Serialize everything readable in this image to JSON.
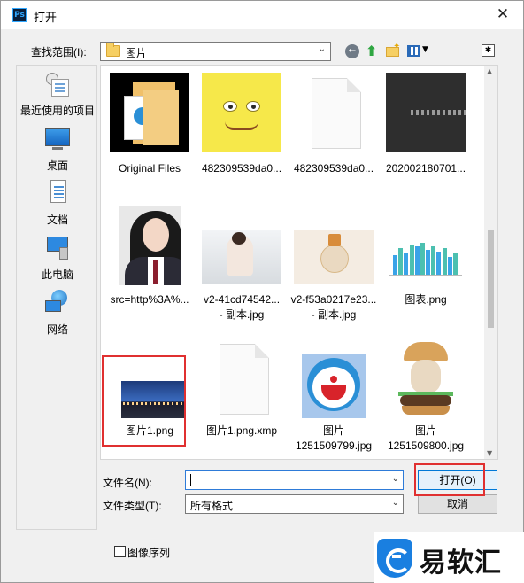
{
  "window": {
    "app_icon_text": "Ps",
    "title": "打开",
    "close_glyph": "✕"
  },
  "toolbar": {
    "lookin_label": "查找范围(I):",
    "lookin_value": "图片",
    "icons": [
      "back-icon",
      "up-folder-icon",
      "new-folder-icon",
      "view-menu-icon",
      "favorite-icon"
    ]
  },
  "places": [
    {
      "label": "最近使用的项目",
      "icon": "recent-items-icon"
    },
    {
      "label": "桌面",
      "icon": "desktop-icon"
    },
    {
      "label": "文档",
      "icon": "documents-icon"
    },
    {
      "label": "此电脑",
      "icon": "this-pc-icon"
    },
    {
      "label": "网络",
      "icon": "network-icon"
    }
  ],
  "files": [
    {
      "name": "Original Files",
      "name2": "",
      "kind": "folder"
    },
    {
      "name": "482309539da0...",
      "name2": "",
      "kind": "image"
    },
    {
      "name": "482309539da0...",
      "name2": "",
      "kind": "blank-file"
    },
    {
      "name": "202002180701...",
      "name2": "",
      "kind": "image"
    },
    {
      "name": "src=http%3A%...",
      "name2": "",
      "kind": "image"
    },
    {
      "name": "v2-41cd74542...",
      "name2": "- 副本.jpg",
      "kind": "image"
    },
    {
      "name": "v2-f53a0217e23...",
      "name2": "- 副本.jpg",
      "kind": "image"
    },
    {
      "name": "图表.png",
      "name2": "",
      "kind": "image"
    },
    {
      "name": "图片1.png",
      "name2": "",
      "kind": "image",
      "highlighted": true
    },
    {
      "name": "图片1.png.xmp",
      "name2": "",
      "kind": "blank-file"
    },
    {
      "name": "图片",
      "name2": "1251509799.jpg",
      "kind": "image"
    },
    {
      "name": "图片",
      "name2": "1251509800.jpg",
      "kind": "image"
    }
  ],
  "chart_thumb": {
    "values": [
      0.55,
      0.75,
      0.6,
      0.85,
      0.8,
      0.9,
      0.7,
      0.8,
      0.65,
      0.75,
      0.5,
      0.6
    ],
    "colors": [
      "#3aa3e8",
      "#4cc0b0",
      "#3aa3e8",
      "#4cc0b0",
      "#3aa3e8",
      "#4cc0b0",
      "#3aa3e8",
      "#4cc0b0",
      "#3aa3e8",
      "#4cc0b0",
      "#3aa3e8",
      "#4cc0b0"
    ]
  },
  "bottom": {
    "filename_label": "文件名(N):",
    "filename_value": "",
    "filetype_label": "文件类型(T):",
    "filetype_value": "所有格式",
    "open_label": "打开(O)",
    "cancel_label": "取消",
    "sequence_label": "图像序列"
  },
  "watermark": {
    "brand": "易软汇"
  },
  "colors": {
    "highlight_box": "#e03030",
    "accent": "#0078d7"
  }
}
